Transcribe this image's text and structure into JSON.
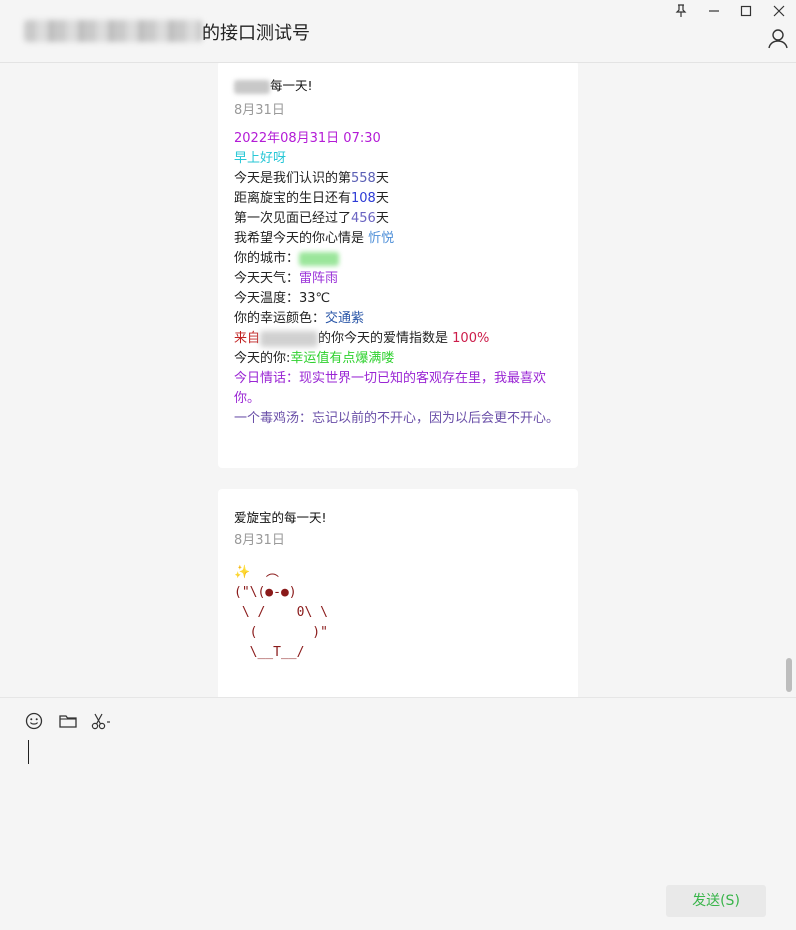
{
  "window": {
    "title_suffix": "的接口测试号",
    "pin_label": "⊥",
    "minimize_label": "—",
    "maximize_label": "☐",
    "close_label": "✕"
  },
  "messages": [
    {
      "title_suffix": "每一天!",
      "date": "8月31日",
      "datetime": "2022年08月31日 07:30",
      "greeting": "早上好呀",
      "line_known_prefix": "今天是我们认识的第",
      "line_known_value": "558",
      "line_known_suffix": "天",
      "line_birthday_prefix": "距离旋宝的生日还有",
      "line_birthday_value": "108",
      "line_birthday_suffix": "天",
      "line_meet_prefix": "第一次见面已经过了",
      "line_meet_value": "456",
      "line_meet_suffix": "天",
      "line_mood_prefix": "我希望今天的你心情是 ",
      "line_mood_value": "忻悦",
      "line_city_prefix": "你的城市：",
      "line_weather_prefix": "今天天气：",
      "line_weather_value": "雷阵雨",
      "line_temp": "今天温度：33℃",
      "line_color_prefix": "你的幸运颜色：",
      "line_color_value": "交通紫",
      "line_love_prefix": "来自",
      "line_love_middle": "的你今天的爱情指数是 ",
      "line_love_value": "100%",
      "line_lucky_prefix": "今天的你:",
      "line_lucky_value": "幸运值有点爆满喽",
      "line_quote": "今日情话：现实世界一切已知的客观存在里，我最喜欢你。",
      "line_soup": "一个毒鸡汤：忘记以前的不开心，因为以后会更不开心。"
    },
    {
      "title": "爱旋宝的每一天!",
      "date": "8月31日",
      "art_sparkle": "✨",
      "art_line1": "  ︵",
      "art_line2": "(\"\\(●-●)",
      "art_line3": " \\ /    0\\ \\",
      "art_line4": "  (       )\"",
      "art_line5": "  \\__T__/"
    }
  ],
  "input": {
    "send_label": "发送(S)"
  },
  "colors": {
    "accent_green": "#39b54a",
    "background": "#f5f5f5"
  }
}
